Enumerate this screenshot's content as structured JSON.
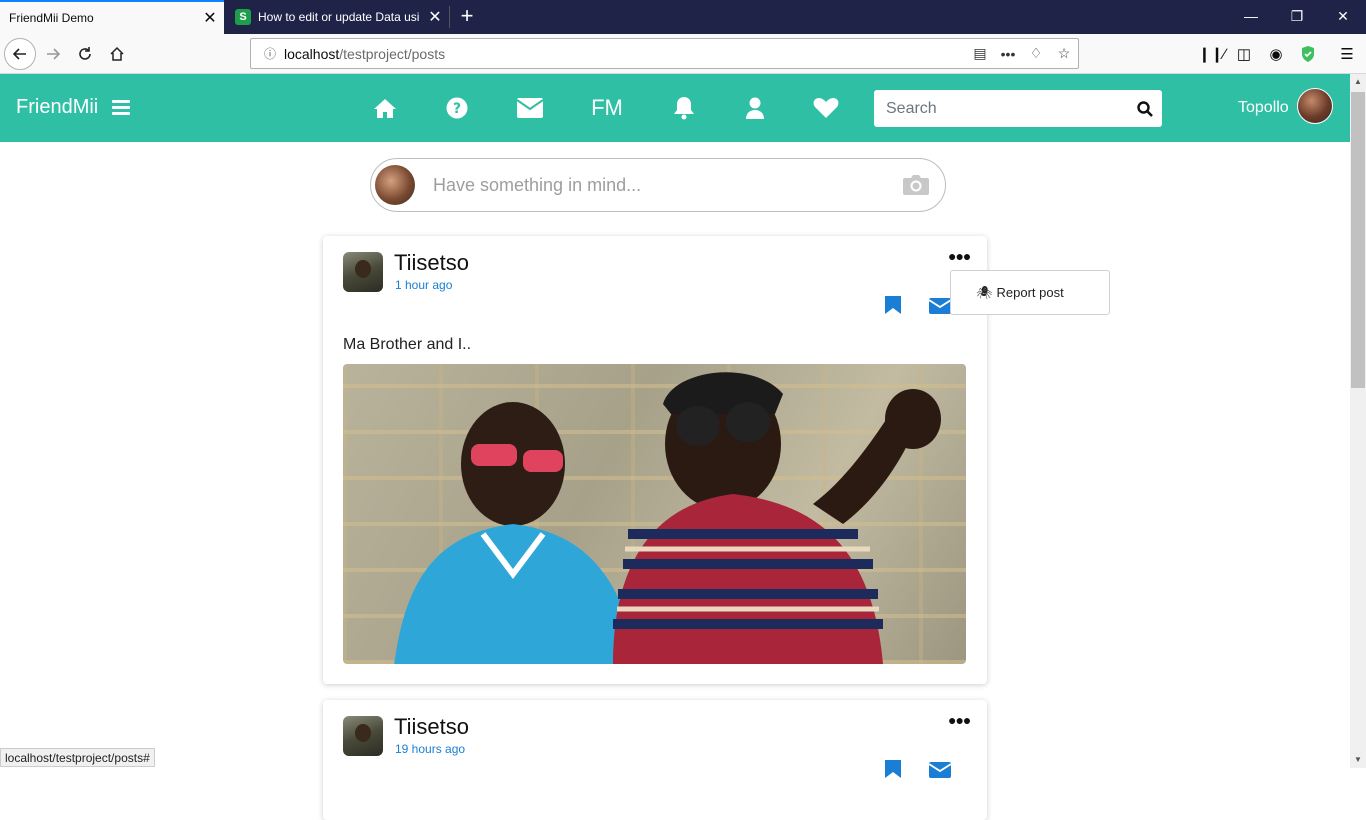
{
  "browser": {
    "tabs": [
      {
        "title": "FriendMii Demo",
        "active": true
      },
      {
        "title": "How to edit or update Data usi",
        "active": false
      }
    ],
    "url": {
      "host": "localhost",
      "path": "/testproject/posts"
    },
    "status_url": "localhost/testproject/posts#"
  },
  "header": {
    "brand": "FriendMii",
    "nav": [
      {
        "name": "home-icon"
      },
      {
        "name": "help-icon"
      },
      {
        "name": "mail-icon"
      },
      {
        "name": "fm",
        "label": "FM"
      },
      {
        "name": "bell-icon"
      },
      {
        "name": "user-icon"
      },
      {
        "name": "heart-icon"
      }
    ],
    "search_placeholder": "Search",
    "user_name": "Topollo",
    "accent": "#2ebfa5"
  },
  "composer": {
    "placeholder": "Have something in mind..."
  },
  "posts": [
    {
      "author": "Tiisetso",
      "time": "1 hour ago",
      "text": "Ma Brother and I.."
    },
    {
      "author": "Tiisetso",
      "time": "19 hours ago"
    }
  ],
  "dropdown": {
    "items": [
      {
        "label": "Report post",
        "icon": "bug-icon"
      }
    ]
  }
}
